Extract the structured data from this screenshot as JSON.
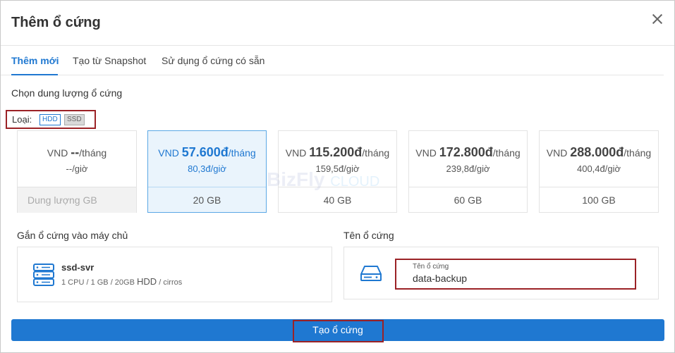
{
  "dialog": {
    "title": "Thêm ổ cứng"
  },
  "tabs": [
    {
      "label": "Thêm mới"
    },
    {
      "label": "Tạo từ Snapshot"
    },
    {
      "label": "Sử dụng ổ cứng có sẵn"
    }
  ],
  "capacity": {
    "heading": "Chọn dung lượng ổ cứng",
    "type_label": "Loại:",
    "types": [
      "HDD",
      "SSD"
    ],
    "selected_type": "HDD",
    "cards": [
      {
        "currency": "VND",
        "price": "--",
        "unit": "/tháng",
        "hourly": "--/giờ",
        "size": "Dung lượng GB"
      },
      {
        "currency": "VND",
        "price": "57.600đ",
        "unit": "/tháng",
        "hourly": "80,3đ/giờ",
        "size": "20 GB"
      },
      {
        "currency": "VND",
        "price": "115.200đ",
        "unit": "/tháng",
        "hourly": "159,5đ/giờ",
        "size": "40 GB"
      },
      {
        "currency": "VND",
        "price": "172.800đ",
        "unit": "/tháng",
        "hourly": "239,8đ/giờ",
        "size": "60 GB"
      },
      {
        "currency": "VND",
        "price": "288.000đ",
        "unit": "/tháng",
        "hourly": "400,4đ/giờ",
        "size": "100 GB"
      }
    ],
    "selected_index": 1
  },
  "watermark": {
    "brand": "BizFly",
    "suffix": "CLOUD"
  },
  "attach": {
    "heading": "Gắn ổ cứng vào máy chủ",
    "server_name": "ssd-svr",
    "spec_prefix": "1 CPU / 1 GB / 20GB",
    "spec_disk": "HDD",
    "spec_suffix": "/ cirros"
  },
  "disk_name": {
    "heading": "Tên ổ cứng",
    "field_label": "Tên ổ cứng",
    "value": "data-backup"
  },
  "submit": {
    "label": "Tạo ổ cứng"
  },
  "colors": {
    "accent": "#1f78d1",
    "highlight": "#9b2226"
  },
  "icons": [
    "close-icon",
    "server-icon",
    "disk-icon"
  ]
}
